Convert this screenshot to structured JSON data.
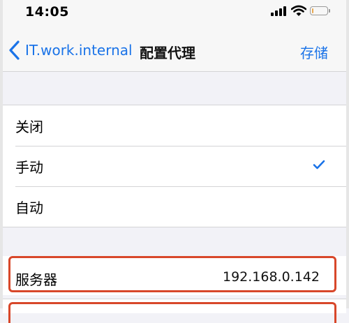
{
  "status_bar": {
    "time": "14:05"
  },
  "nav": {
    "back_label": "IT.work.internal",
    "title": "配置代理",
    "save_label": "存储"
  },
  "proxy_modes": [
    {
      "label": "关闭",
      "selected": false
    },
    {
      "label": "手动",
      "selected": true
    },
    {
      "label": "自动",
      "selected": false
    }
  ],
  "server": {
    "label": "服务器",
    "value": "192.168.0.142"
  },
  "colors": {
    "accent": "#1a73e8",
    "highlight": "#d8472a",
    "battery": "#e8a74f",
    "background": "#f2f2f7"
  },
  "battery_level": 0.1
}
